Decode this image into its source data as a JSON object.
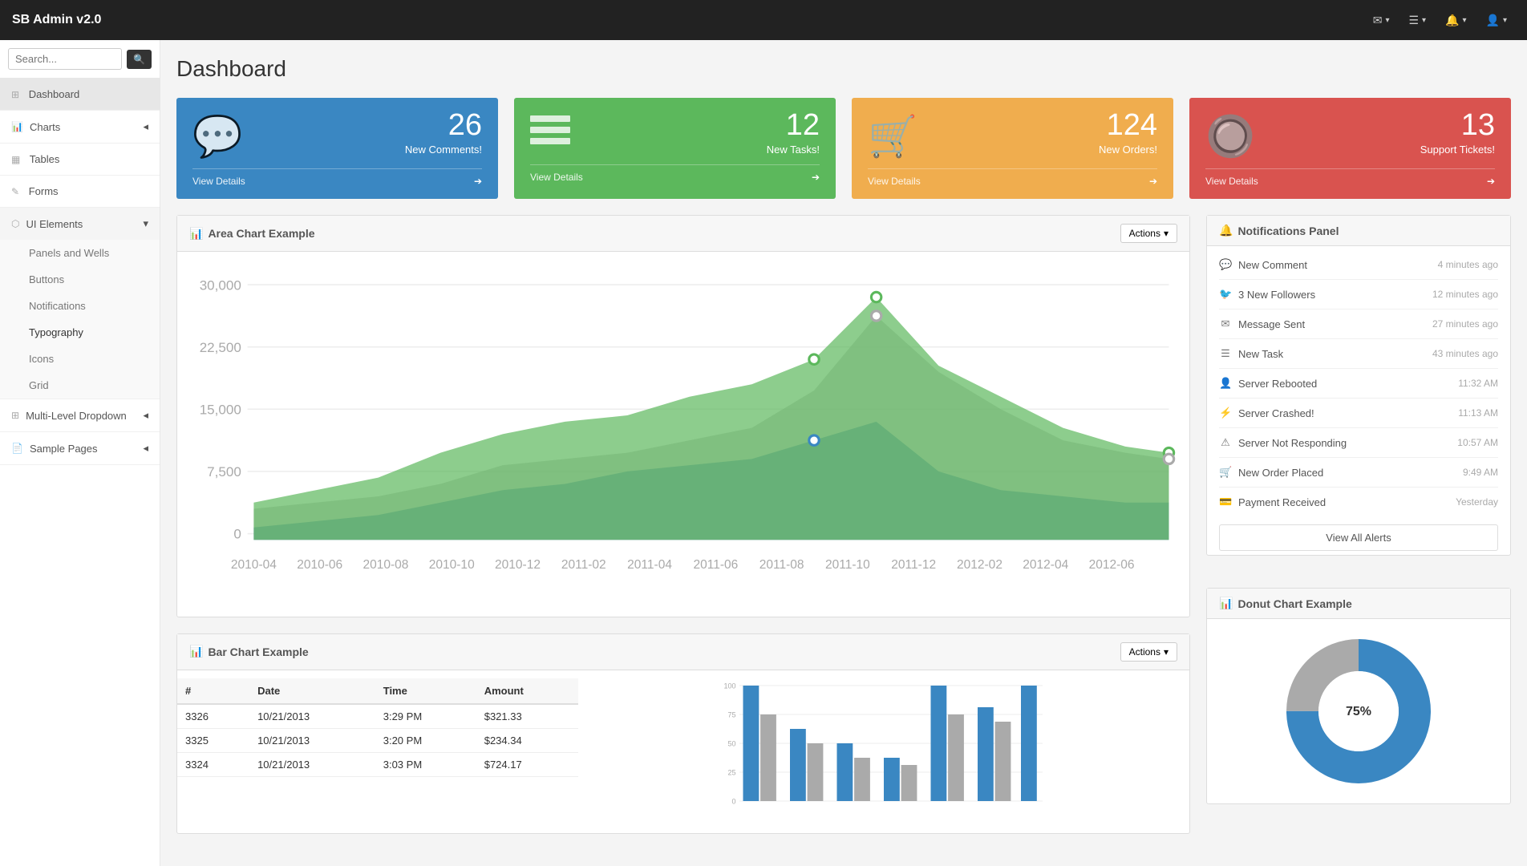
{
  "navbar": {
    "brand": "SB Admin v2.0",
    "icons": [
      {
        "name": "envelope-icon",
        "symbol": "✉",
        "label": "Messages"
      },
      {
        "name": "list-icon",
        "symbol": "☰",
        "label": "Tasks"
      },
      {
        "name": "bell-icon",
        "symbol": "🔔",
        "label": "Alerts"
      },
      {
        "name": "user-icon",
        "symbol": "👤",
        "label": "User"
      }
    ]
  },
  "sidebar": {
    "search_placeholder": "Search...",
    "items": [
      {
        "id": "dashboard",
        "label": "Dashboard",
        "icon": "⊞",
        "active": true,
        "hasSubmenu": false
      },
      {
        "id": "charts",
        "label": "Charts",
        "icon": "📊",
        "active": false,
        "hasSubmenu": true,
        "caret": "◂"
      },
      {
        "id": "tables",
        "label": "Tables",
        "icon": "▦",
        "active": false,
        "hasSubmenu": false
      },
      {
        "id": "forms",
        "label": "Forms",
        "icon": "✎",
        "active": false,
        "hasSubmenu": false
      },
      {
        "id": "ui-elements",
        "label": "UI Elements",
        "icon": "⬡",
        "active": true,
        "hasSubmenu": true,
        "expanded": true,
        "caret": "▾"
      }
    ],
    "submenu_items": [
      {
        "id": "panels-wells",
        "label": "Panels and Wells"
      },
      {
        "id": "buttons",
        "label": "Buttons"
      },
      {
        "id": "notifications",
        "label": "Notifications"
      },
      {
        "id": "typography",
        "label": "Typography",
        "active": true
      },
      {
        "id": "icons",
        "label": "Icons"
      },
      {
        "id": "grid",
        "label": "Grid"
      }
    ],
    "bottom_items": [
      {
        "id": "multi-level",
        "label": "Multi-Level Dropdown",
        "icon": "⊞",
        "caret": "◂"
      },
      {
        "id": "sample-pages",
        "label": "Sample Pages",
        "icon": "📄",
        "caret": "◂"
      }
    ]
  },
  "page": {
    "title": "Dashboard"
  },
  "stat_cards": [
    {
      "id": "comments",
      "number": "26",
      "label": "New Comments!",
      "icon": "💬",
      "color": "blue",
      "footer_link": "View Details",
      "footer_icon": "➔"
    },
    {
      "id": "tasks",
      "number": "12",
      "label": "New Tasks!",
      "icon": "☰",
      "color": "green",
      "footer_link": "View Details",
      "footer_icon": "➔"
    },
    {
      "id": "orders",
      "number": "124",
      "label": "New Orders!",
      "icon": "🛒",
      "color": "orange",
      "footer_link": "View Details",
      "footer_icon": "➔"
    },
    {
      "id": "support",
      "number": "13",
      "label": "Support Tickets!",
      "icon": "🔘",
      "color": "red",
      "footer_link": "View Details",
      "footer_icon": "➔"
    }
  ],
  "area_chart": {
    "title": "Area Chart Example",
    "actions_label": "Actions",
    "x_labels": [
      "2010-04",
      "2010-06",
      "2010-08",
      "2010-10",
      "2010-12",
      "2011-02",
      "2011-04",
      "2011-06",
      "2011-08",
      "2011-10",
      "2011-12",
      "2012-02",
      "2012-04",
      "2012-06"
    ],
    "y_labels": [
      "30,000",
      "22,500",
      "15,000",
      "7,500",
      "0"
    ]
  },
  "bar_chart": {
    "title": "Bar Chart Example",
    "actions_label": "Actions",
    "table_headers": [
      "#",
      "Date",
      "Time",
      "Amount"
    ],
    "table_rows": [
      [
        "3326",
        "10/21/2013",
        "3:29 PM",
        "$321.33"
      ],
      [
        "3325",
        "10/21/2013",
        "3:20 PM",
        "$234.34"
      ],
      [
        "3324",
        "10/21/2013",
        "3:03 PM",
        "$724.17"
      ]
    ],
    "y_labels": [
      "100",
      "75",
      "50",
      "25",
      "0"
    ]
  },
  "notifications_panel": {
    "title": "Notifications Panel",
    "items": [
      {
        "icon": "💬",
        "text": "New Comment",
        "time": "4 minutes ago"
      },
      {
        "icon": "🐦",
        "text": "3 New Followers",
        "time": "12 minutes ago"
      },
      {
        "icon": "✉",
        "text": "Message Sent",
        "time": "27 minutes ago"
      },
      {
        "icon": "☰",
        "text": "New Task",
        "time": "43 minutes ago"
      },
      {
        "icon": "👤",
        "text": "Server Rebooted",
        "time": "11:32 AM"
      },
      {
        "icon": "⚡",
        "text": "Server Crashed!",
        "time": "11:13 AM"
      },
      {
        "icon": "⚠",
        "text": "Server Not Responding",
        "time": "10:57 AM"
      },
      {
        "icon": "🛒",
        "text": "New Order Placed",
        "time": "9:49 AM"
      },
      {
        "icon": "💳",
        "text": "Payment Received",
        "time": "Yesterday"
      }
    ],
    "view_all_label": "View All Alerts"
  },
  "donut_chart": {
    "title": "Donut Chart Example"
  }
}
